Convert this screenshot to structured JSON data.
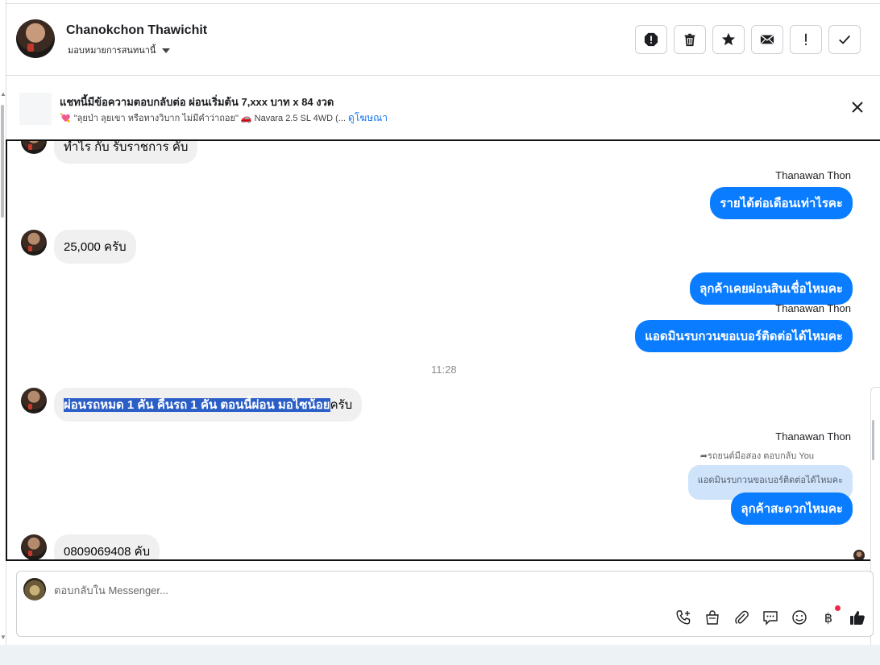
{
  "header": {
    "name": "Chanokchon Thawichit",
    "assign_label": "มอบหมายการสนทนานี้"
  },
  "actions": [
    {
      "name": "spam-icon"
    },
    {
      "name": "trash-icon"
    },
    {
      "name": "star-icon"
    },
    {
      "name": "mail-icon"
    },
    {
      "name": "exclamation-icon"
    },
    {
      "name": "check-icon"
    }
  ],
  "ad": {
    "title": "แชทนี้มีข้อความตอบกลับต่อ ผ่อนเริ่มต้น 7,xxx บาท x 84 งวด",
    "subtitle": "\"ลุยป่า ลุยเขา หรือทางวิบาก ไม่มีคำว่าถอย\" 🚗 Navara 2.5 SL 4WD (...",
    "link": "ดูโฆษณา"
  },
  "messages": {
    "partial_top": "ทำไร กับ รับราชการ คับ",
    "m1_sender": "Thanawan Thon",
    "m1_text": "รายได้ต่อเดือนเท่าไรคะ",
    "m2_text": "25,000 ครับ",
    "m3_text": "ลุกค้าเคยผ่อนสินเชื่อไหมคะ",
    "m4_sender": "Thanawan Thon",
    "m4_text": "แอดมินรบกวนขอเบอร์ติดต่อได้ไหมคะ",
    "time": "11:28",
    "m5_selected": "ผ่อนรถหมด 1 คัน คืนรถ 1 คัน ตอนนี้ผ่อน มอไซน้อย",
    "m5_rest": "ครับ",
    "m6_sender": "Thanawan Thon",
    "m6_reply_note": "รถยนต์มือสอง ตอบกลับ You",
    "m6_quote": "แอดมินรบกวนขอเบอร์ติดต่อได้ไหมคะ",
    "m6_text": "ลุกค้าสะดวกไหมคะ",
    "m7_text": "0809069408 คับ"
  },
  "composer": {
    "placeholder": "ตอบกลับใน Messenger..."
  },
  "tools": [
    {
      "name": "phone-add-icon"
    },
    {
      "name": "shopping-bag-icon"
    },
    {
      "name": "paperclip-icon"
    },
    {
      "name": "chat-bubble-icon"
    },
    {
      "name": "emoji-icon"
    },
    {
      "name": "baht-icon",
      "glyph": "฿"
    },
    {
      "name": "thumbs-up-icon"
    }
  ],
  "colors": {
    "outgoing": "#0a7cff",
    "incoming": "#f0f0f0",
    "link": "#1877f2",
    "selection": "#2b5fc7",
    "notify_dot": "#f02849"
  }
}
